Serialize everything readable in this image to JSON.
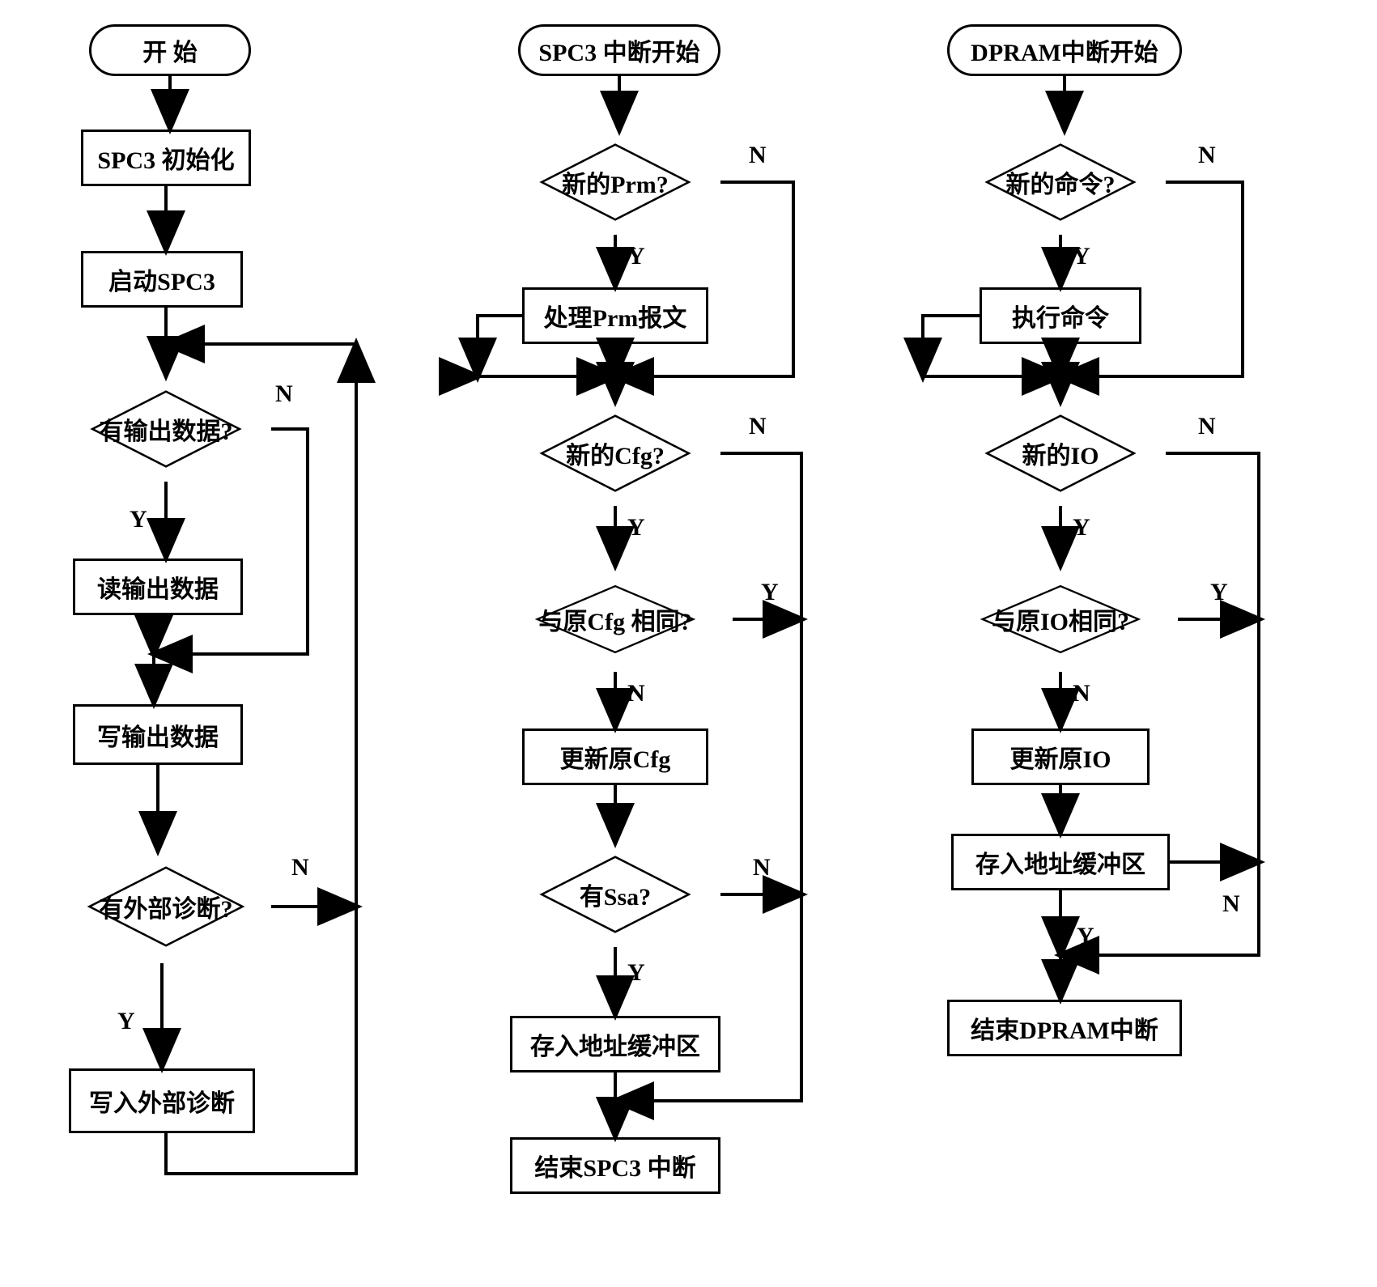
{
  "labels": {
    "Y": "Y",
    "N": "N"
  },
  "col1": {
    "start": "开    始",
    "init": "SPC3 初始化",
    "run": "启动SPC3",
    "q_out": "有输出数据?",
    "read_out": "读输出数据",
    "write_out": "写输出数据",
    "q_diag": "有外部诊断?",
    "write_diag": "写入外部诊断"
  },
  "col2": {
    "start": "SPC3 中断开始",
    "q_prm": "新的Prm?",
    "proc_prm": "处理Prm报文",
    "q_cfg": "新的Cfg?",
    "q_cfg_same": "与原Cfg 相同?",
    "upd_cfg": "更新原Cfg",
    "q_ssa": "有Ssa?",
    "store": "存入地址缓冲区",
    "end": "结束SPC3 中断"
  },
  "col3": {
    "start": "DPRAM中断开始",
    "q_cmd": "新的命令?",
    "exec": "执行命令",
    "q_io": "新的IO",
    "q_io_same": "与原IO相同?",
    "upd_io": "更新原IO",
    "store": "存入地址缓冲区",
    "end": "结束DPRAM中断"
  }
}
